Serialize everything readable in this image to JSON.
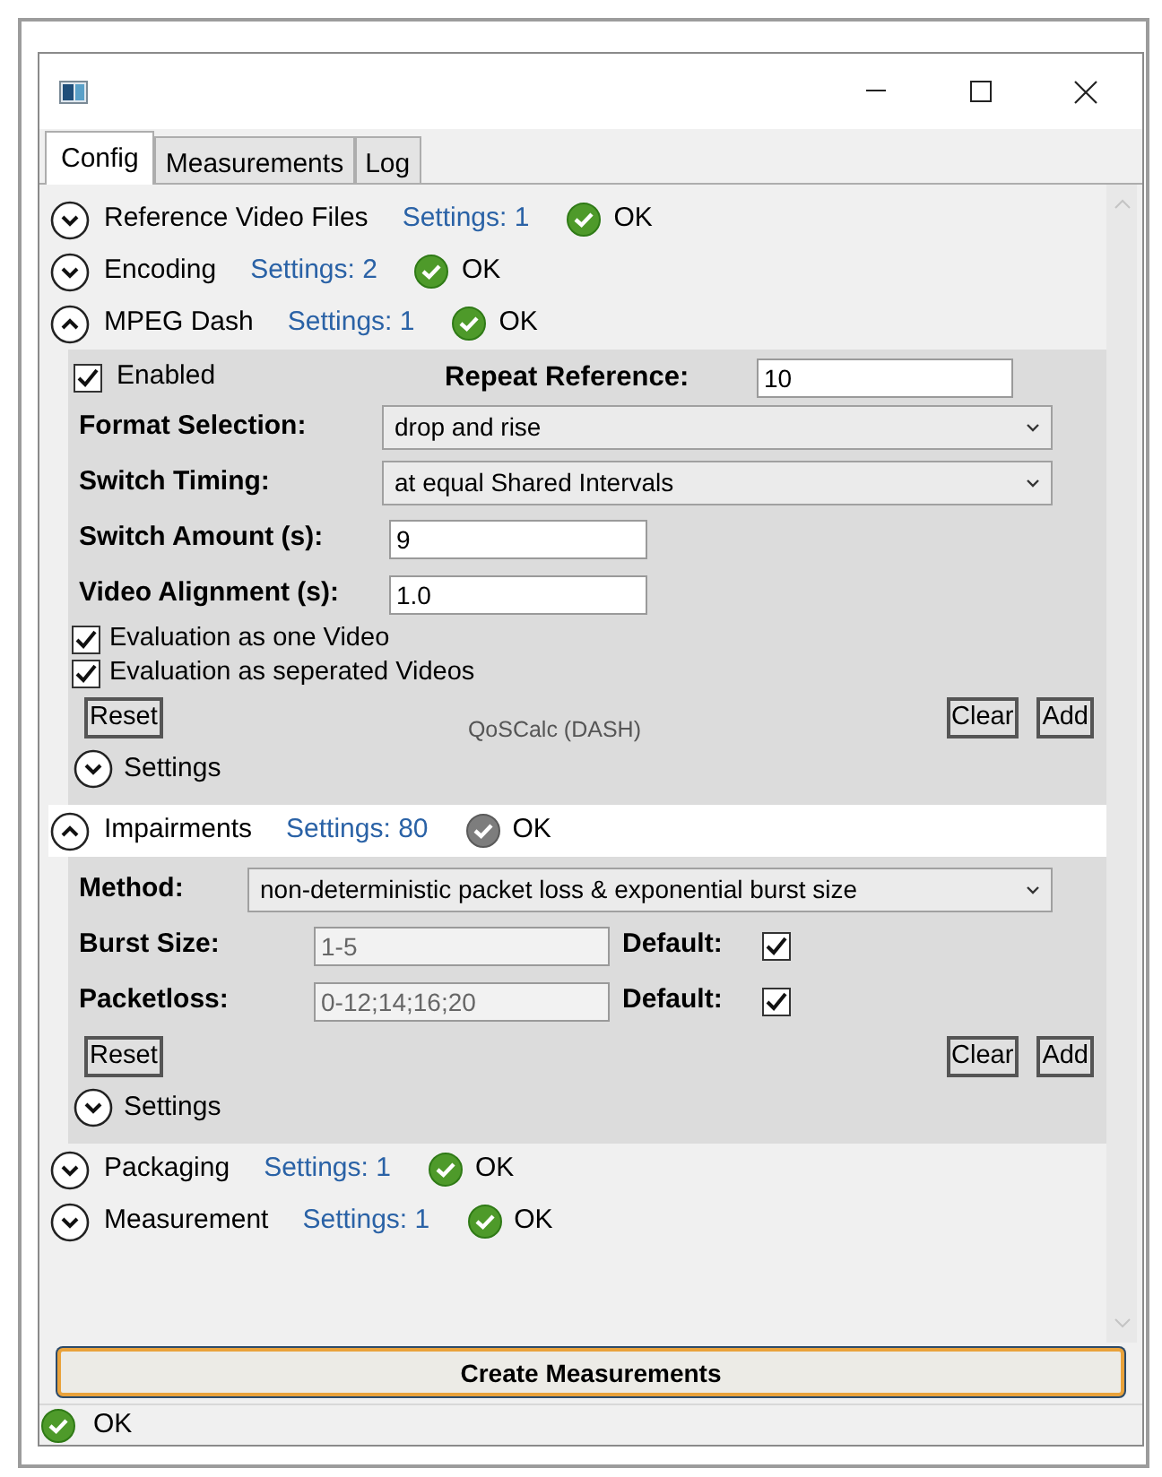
{
  "tabs": [
    {
      "label": "Config",
      "selected": true
    },
    {
      "label": "Measurements",
      "selected": false
    },
    {
      "label": "Log",
      "selected": false
    }
  ],
  "sections": [
    {
      "title": "Reference Video Files",
      "settings": "Settings: 1",
      "status": "OK",
      "expanded": false,
      "dimmed": false
    },
    {
      "title": "Encoding",
      "settings": "Settings: 2",
      "status": "OK",
      "expanded": false,
      "dimmed": false
    },
    {
      "title": "MPEG Dash",
      "settings": "Settings: 1",
      "status": "OK",
      "expanded": true,
      "dimmed": false,
      "panel": {
        "kind": "dash",
        "rows": [
          {
            "kind": "enabled-repeat",
            "checkbox_label": "Enabled",
            "checked": true,
            "label": "Repeat Reference:",
            "value": "10"
          },
          {
            "kind": "select",
            "label": "Format Selection:",
            "value": "drop and rise"
          },
          {
            "kind": "select",
            "label": "Switch Timing:",
            "value": "at equal Shared Intervals"
          },
          {
            "kind": "field",
            "label": "Switch Amount (s):",
            "value": "9"
          },
          {
            "kind": "field",
            "label": "Video Alignment (s):",
            "value": "1.0"
          },
          {
            "kind": "checkbox",
            "label": "Evaluation as one Video",
            "checked": true
          },
          {
            "kind": "checkbox",
            "label": "Evaluation as seperated Videos",
            "checked": true
          },
          {
            "kind": "actions",
            "buttons": [
              "Reset",
              "Clear",
              "Add"
            ],
            "caption": "QoSCalc (DASH)"
          },
          {
            "kind": "expander",
            "label": "Settings",
            "expanded": false
          }
        ]
      }
    },
    {
      "title": "Impairments",
      "settings": "Settings: 80",
      "status": "OK",
      "expanded": true,
      "dimmed": true,
      "panel": {
        "kind": "impairments",
        "rows": [
          {
            "kind": "select",
            "label": "Method:",
            "value": "non-deterministic packet loss & exponential burst size"
          },
          {
            "kind": "field-default",
            "label": "Burst Size:",
            "value": "1-5",
            "default_label": "Default:",
            "checked": true,
            "disabled": true
          },
          {
            "kind": "field-default",
            "label": "Packetloss:",
            "value": "0-12;14;16;20",
            "default_label": "Default:",
            "checked": true,
            "disabled": true
          },
          {
            "kind": "actions",
            "buttons": [
              "Reset",
              "Clear",
              "Add"
            ]
          },
          {
            "kind": "expander",
            "label": "Settings",
            "expanded": false
          }
        ]
      }
    },
    {
      "title": "Packaging",
      "settings": "Settings: 1",
      "status": "OK",
      "expanded": false,
      "dimmed": false
    },
    {
      "title": "Measurement",
      "settings": "Settings: 1",
      "status": "OK",
      "expanded": false,
      "dimmed": false
    }
  ],
  "create_button": "Create Measurements",
  "status_bar": {
    "text": "OK"
  }
}
